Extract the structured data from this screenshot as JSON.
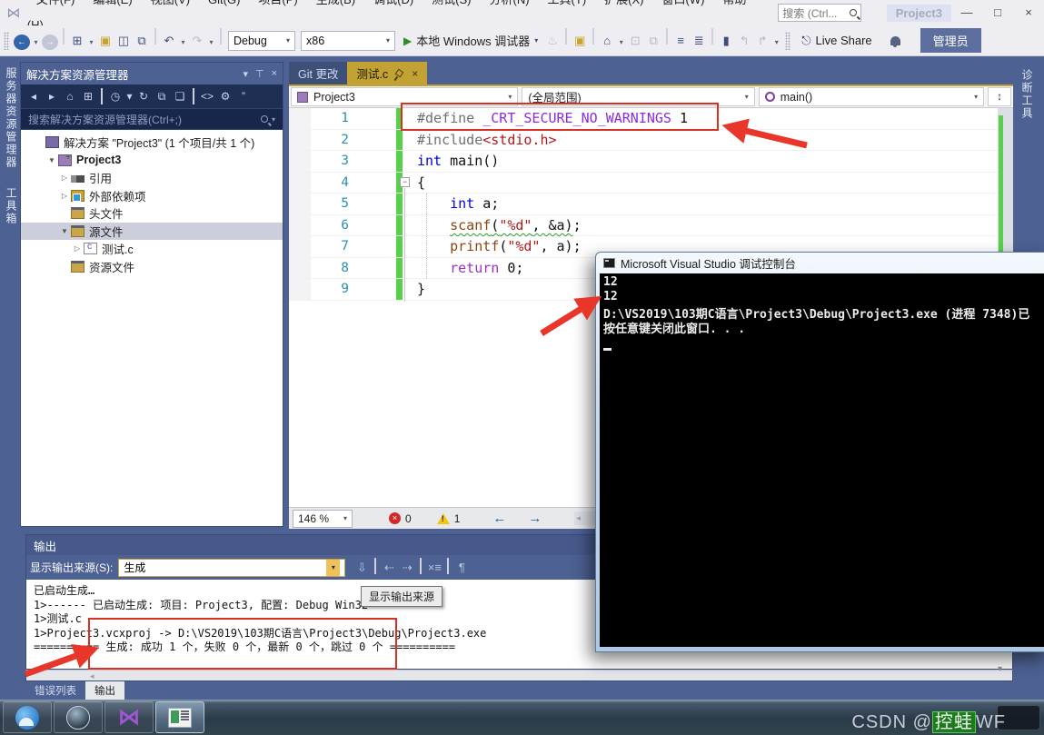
{
  "titlebar": {
    "menus": [
      "文件(F)",
      "编辑(E)",
      "视图(V)",
      "Git(G)",
      "项目(P)",
      "生成(B)",
      "调试(D)",
      "测试(S)",
      "分析(N)",
      "工具(T)",
      "扩展(X)",
      "窗口(W)",
      "帮助(H)"
    ],
    "search_placeholder": "搜索 (Ctrl...",
    "feedback_label": "Project3",
    "minimize": "—",
    "maximize": "□",
    "close": "×"
  },
  "toolbar": {
    "left_icons": [
      {
        "n": "back-icon",
        "g": "←",
        "cls": "circle-blue"
      },
      {
        "n": "back-caret-icon",
        "g": "▾",
        "cls": "caret"
      },
      {
        "n": "forward-icon",
        "g": "→",
        "cls": "circle-gray"
      },
      {
        "n": "separator",
        "cls": "sep"
      },
      {
        "n": "new-project-icon",
        "g": "⊞"
      },
      {
        "n": "new-caret-icon",
        "g": "▾",
        "cls": "caret"
      },
      {
        "n": "open-file-icon",
        "g": "▣",
        "cls": "gold"
      },
      {
        "n": "save-icon",
        "g": "◫"
      },
      {
        "n": "save-all-icon",
        "g": "⧉"
      },
      {
        "n": "separator",
        "cls": "sep"
      },
      {
        "n": "undo-icon",
        "g": "↶"
      },
      {
        "n": "undo-caret-icon",
        "g": "▾",
        "cls": "caret"
      },
      {
        "n": "redo-icon",
        "g": "↷",
        "cls": "dim"
      },
      {
        "n": "redo-caret-icon",
        "g": "▾",
        "cls": "caret"
      },
      {
        "n": "separator",
        "cls": "sep"
      }
    ],
    "configuration": "Debug",
    "platform": "x86",
    "run_label": "本地 Windows 调试器",
    "right_icons": [
      {
        "n": "hot-reload-icon",
        "g": "♨",
        "cls": "dim"
      },
      {
        "n": "separator",
        "cls": "sep"
      },
      {
        "n": "find-in-files-icon",
        "g": "▣",
        "cls": "gold"
      },
      {
        "n": "separator",
        "cls": "sep"
      },
      {
        "n": "home-icon",
        "g": "⌂"
      },
      {
        "n": "home-caret-icon",
        "g": "▾",
        "cls": "caret"
      },
      {
        "n": "box-selection-icon",
        "g": "⊡",
        "cls": "dim"
      },
      {
        "n": "clone-code-icon",
        "g": "⧉",
        "cls": "dim"
      },
      {
        "n": "separator",
        "cls": "sep"
      },
      {
        "n": "indent-icon",
        "g": "≡"
      },
      {
        "n": "unindent-icon",
        "g": "≣"
      },
      {
        "n": "separator",
        "cls": "sep"
      },
      {
        "n": "bookmark-icon",
        "g": "▮"
      },
      {
        "n": "prev-bookmark-icon",
        "g": "↰",
        "cls": "dim"
      },
      {
        "n": "next-bookmark-icon",
        "g": "↱",
        "cls": "dim"
      },
      {
        "n": "bookmark-caret-icon",
        "g": "▾",
        "cls": "caret"
      }
    ],
    "live_share_label": "Live Share",
    "admin_badge": "管理员"
  },
  "left_strip": {
    "tabs": [
      "服务器资源管理器",
      "工具箱"
    ]
  },
  "solution_explorer": {
    "title": "解决方案资源管理器",
    "toolbar_icons": [
      {
        "n": "se-back-icon",
        "g": "◂",
        "cls": "dim"
      },
      {
        "n": "se-forward-icon",
        "g": "▸",
        "cls": "dim"
      },
      {
        "n": "se-home-icon",
        "g": "⌂"
      },
      {
        "n": "se-switch-views-icon",
        "g": "⊞"
      },
      {
        "n": "separator",
        "cls": "sep"
      },
      {
        "n": "se-pending-changes-icon",
        "g": "◷"
      },
      {
        "n": "se-pending-caret-icon",
        "g": "▾",
        "cls": "caret"
      },
      {
        "n": "se-refresh-icon",
        "g": "↻"
      },
      {
        "n": "se-collapse-all-icon",
        "g": "⧉"
      },
      {
        "n": "se-show-all-files-icon",
        "g": "❏"
      },
      {
        "n": "separator",
        "cls": "sep"
      },
      {
        "n": "se-view-code-icon",
        "g": "<>"
      },
      {
        "n": "se-properties-icon",
        "g": "⚙",
        "cls": "gold"
      },
      {
        "n": "se-overflow-icon",
        "g": "”"
      }
    ],
    "search_placeholder": "搜索解决方案资源管理器(Ctrl+;)",
    "tree": [
      {
        "label": "解决方案 \"Project3\" (1 个项目/共 1 个)",
        "icon": "solution-icon",
        "indent": 1,
        "exp": "none",
        "bold": false,
        "selected": false
      },
      {
        "label": "Project3",
        "icon": "project-icon",
        "indent": 2,
        "exp": "open",
        "bold": true,
        "selected": false
      },
      {
        "label": "引用",
        "icon": "references-icon",
        "indent": 3,
        "exp": "closed",
        "bold": false,
        "selected": false
      },
      {
        "label": "外部依赖项",
        "icon": "ext-deps-icon",
        "indent": 3,
        "exp": "closed",
        "bold": false,
        "selected": false
      },
      {
        "label": "头文件",
        "icon": "filter-folder-icon",
        "indent": 3,
        "exp": "none",
        "bold": false,
        "selected": false
      },
      {
        "label": "源文件",
        "icon": "filter-folder-icon",
        "indent": 3,
        "exp": "open",
        "bold": false,
        "selected": true
      },
      {
        "label": "测试.c",
        "icon": "c-file-icon",
        "indent": 4,
        "exp": "closed",
        "bold": false,
        "selected": false
      },
      {
        "label": "资源文件",
        "icon": "filter-folder-icon",
        "indent": 3,
        "exp": "none",
        "bold": false,
        "selected": false
      }
    ]
  },
  "editor": {
    "tabs": [
      {
        "label": "Git 更改",
        "active": false
      },
      {
        "label": "测试.c",
        "active": true
      }
    ],
    "navbar": {
      "project": "Project3",
      "scope": "(全局范围)",
      "member": "main()",
      "split_glyph": "↕"
    },
    "code_lines": [
      {
        "num": "1",
        "tokens": [
          {
            "t": "#define ",
            "c": "tk-dir"
          },
          {
            "t": "_CRT_SECURE_NO_WARNINGS",
            "c": "tk-macro"
          },
          {
            "t": " 1",
            "c": "tk-plain"
          }
        ]
      },
      {
        "num": "2",
        "tokens": [
          {
            "t": "#include",
            "c": "tk-dir"
          },
          {
            "t": "<stdio.h>",
            "c": "tk-str"
          }
        ]
      },
      {
        "num": "3",
        "tokens": [
          {
            "t": "int",
            "c": "tk-kw"
          },
          {
            "t": " main()",
            "c": "tk-plain"
          }
        ]
      },
      {
        "num": "4",
        "tokens": [
          {
            "t": "{",
            "c": "tk-plain"
          }
        ]
      },
      {
        "num": "5",
        "tokens": [
          {
            "t": "    ",
            "c": "tk-plain"
          },
          {
            "t": "int",
            "c": "tk-kw"
          },
          {
            "t": " a;",
            "c": "tk-plain"
          }
        ]
      },
      {
        "num": "6",
        "tokens": [
          {
            "t": "    ",
            "c": "tk-plain"
          },
          {
            "t": "scanf",
            "c": "tk-fn sq"
          },
          {
            "t": "(",
            "c": "tk-plain sq"
          },
          {
            "t": "\"%d\"",
            "c": "tk-str sq"
          },
          {
            "t": ", &a)",
            "c": "tk-plain sq"
          },
          {
            "t": ";",
            "c": "tk-plain"
          }
        ]
      },
      {
        "num": "7",
        "tokens": [
          {
            "t": "    ",
            "c": "tk-plain"
          },
          {
            "t": "printf",
            "c": "tk-fn"
          },
          {
            "t": "(",
            "c": "tk-plain"
          },
          {
            "t": "\"%d\"",
            "c": "tk-str"
          },
          {
            "t": ", a);",
            "c": "tk-plain"
          }
        ]
      },
      {
        "num": "8",
        "tokens": [
          {
            "t": "    ",
            "c": "tk-plain"
          },
          {
            "t": "return",
            "c": "tk-kwp"
          },
          {
            "t": " 0;",
            "c": "tk-plain"
          }
        ]
      },
      {
        "num": "9",
        "tokens": [
          {
            "t": "}",
            "c": "tk-plain"
          }
        ]
      }
    ],
    "collapse_glyph": "−",
    "status": {
      "zoom": "146 %",
      "errors": "0",
      "warnings": "1",
      "back_arrow": "←",
      "fwd_arrow": "→"
    }
  },
  "right_strip": {
    "tabs": [
      "诊断工具"
    ]
  },
  "output_panel": {
    "title": "输出",
    "source_label": "显示输出来源(S):",
    "source_value": "生成",
    "icons": [
      {
        "n": "out-jump-icon",
        "g": "⇩",
        "cls": "dim"
      },
      {
        "n": "separator",
        "cls": "sep"
      },
      {
        "n": "out-prev-message-icon",
        "g": "⇠",
        "cls": "dim"
      },
      {
        "n": "out-next-message-icon",
        "g": "⇢",
        "cls": "dim"
      },
      {
        "n": "separator",
        "cls": "sep"
      },
      {
        "n": "out-clear-all-icon",
        "g": "×≡"
      },
      {
        "n": "separator",
        "cls": "sep"
      },
      {
        "n": "out-word-wrap-icon",
        "g": "¶"
      }
    ],
    "lines": [
      "已启动生成…",
      "1>------ 已启动生成: 项目: Project3, 配置: Debug Win32 ------",
      "1>测试.c",
      "1>Project3.vcxproj -> D:\\VS2019\\103期C语言\\Project3\\Debug\\Project3.exe",
      "========== 生成: 成功 1 个，失败 0 个，最新 0 个，跳过 0 个 =========="
    ],
    "tabs": [
      {
        "label": "错误列表",
        "active": false
      },
      {
        "label": "输出",
        "active": true
      }
    ],
    "tooltip": "显示输出来源"
  },
  "console": {
    "title": "Microsoft Visual Studio 调试控制台",
    "lines": [
      "12",
      "12",
      "D:\\VS2019\\103期C语言\\Project3\\Debug\\Project3.exe (进程 7348)已",
      "按任意键关闭此窗口. . ."
    ]
  },
  "taskbar": {
    "apps": [
      "qq-browser",
      "image-viewer",
      "visual-studio",
      "console-app"
    ],
    "active_index": 3
  },
  "watermark": {
    "prefix": "CSDN @",
    "highlight": "控蛙",
    "suffix": "WF"
  },
  "colors": {
    "accent_steel_blue": "#4D6192",
    "dark_navy": "#1F2F54",
    "tab_gold": "#C2A135",
    "change_bar_green": "#57D04B",
    "annotation_red": "#D93025",
    "error_red": "#D02A2A",
    "warning_yellow": "#F2C811"
  }
}
